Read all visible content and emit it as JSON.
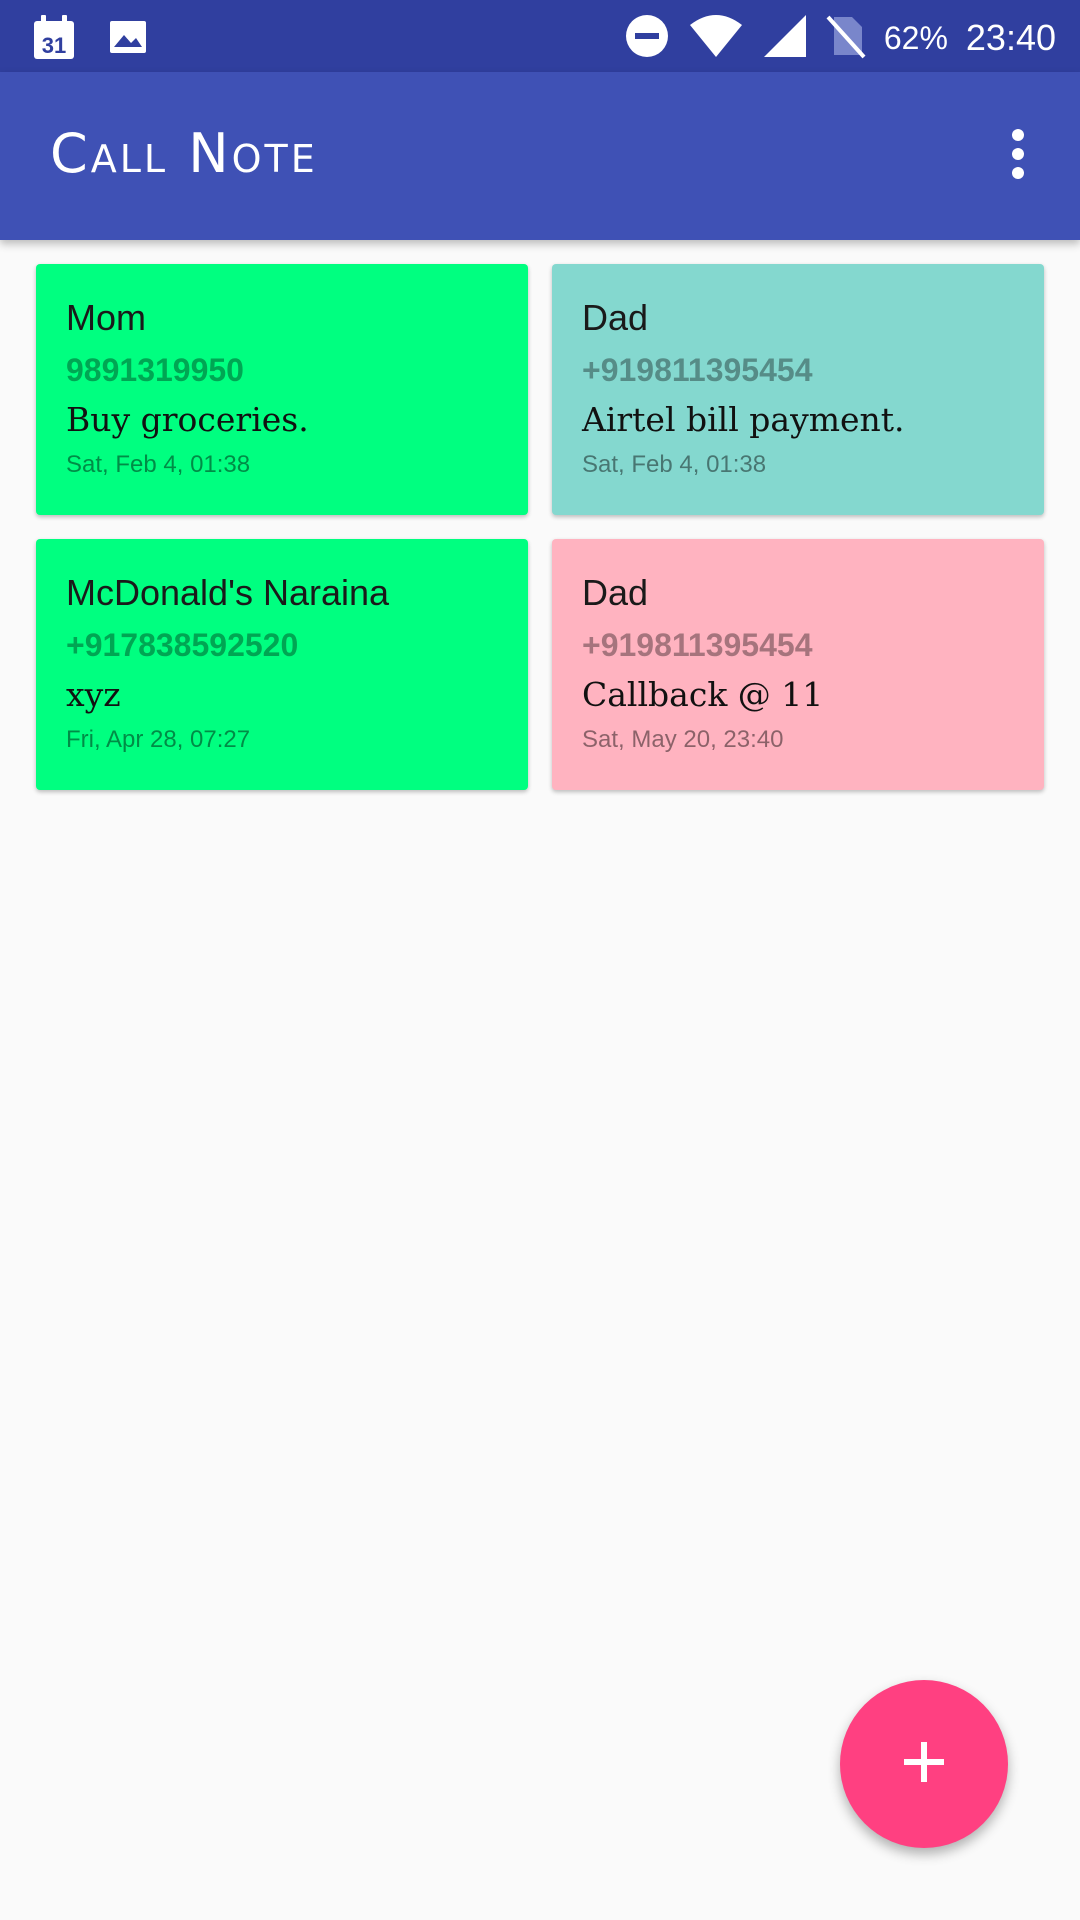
{
  "status_bar": {
    "left_icons": [
      "calendar-icon",
      "image-icon"
    ],
    "calendar_day": "31",
    "right_icons": [
      "do-not-disturb-icon",
      "wifi-icon",
      "cell-signal-icon",
      "no-sim-icon"
    ],
    "battery": "62%",
    "time": "23:40"
  },
  "app_bar": {
    "title": "Call Note",
    "overflow_icon": "more-vert-icon"
  },
  "notes": [
    {
      "name": "Mom",
      "phone": "9891319950",
      "text": "Buy groceries.",
      "date": "Sat, Feb 4, 01:38",
      "color": "#00ff80"
    },
    {
      "name": "Dad",
      "phone": "+919811395454",
      "text": "Airtel bill payment.",
      "date": "Sat, Feb 4, 01:38",
      "color": "#84d8cf"
    },
    {
      "name": "McDonald's Naraina",
      "phone": "+917838592520",
      "text": "xyz",
      "date": "Fri, Apr 28, 07:27",
      "color": "#00ff80"
    },
    {
      "name": "Dad",
      "phone": "+919811395454",
      "text": "Callback @ 11",
      "date": "Sat, May 20, 23:40",
      "color": "#ffb3c0"
    }
  ],
  "fab": {
    "icon": "add-icon",
    "color": "#ff4081"
  },
  "colors": {
    "status_bar": "#303f9f",
    "app_bar": "#3f51b5",
    "background": "#fafafa"
  }
}
